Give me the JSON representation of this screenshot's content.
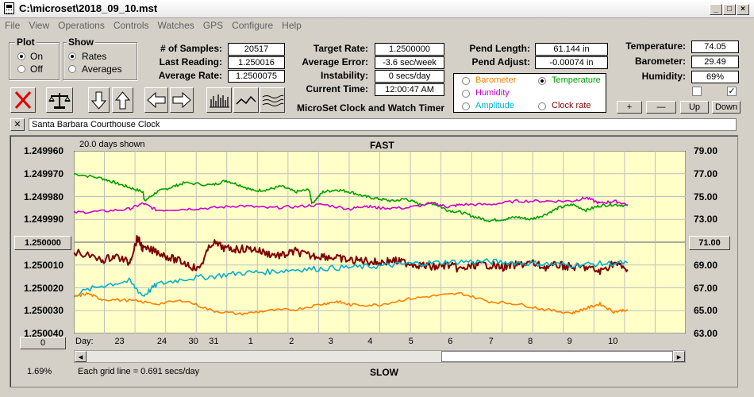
{
  "window": {
    "title": "C:\\microset\\2018_09_10.mst"
  },
  "menu": [
    "File",
    "View",
    "Operations",
    "Controls",
    "Watches",
    "GPS",
    "Configure",
    "Help"
  ],
  "plot_group": {
    "title": "Plot",
    "on": "On",
    "off": "Off",
    "selected": "On"
  },
  "show_group": {
    "title": "Show",
    "rates": "Rates",
    "averages": "Averages",
    "selected": "Rates"
  },
  "stats": {
    "samples_label": "# of Samples:",
    "samples": "20517",
    "last_label": "Last Reading:",
    "last": "1.250016",
    "avg_label": "Average Rate:",
    "avg": "1.2500075"
  },
  "rates": {
    "target_label": "Target Rate:",
    "target": "1.2500000",
    "error_label": "Average Error:",
    "error": "-3.6 sec/week",
    "instab_label": "Instability:",
    "instab": "0 secs/day",
    "time_label": "Current Time:",
    "time": "12:00:47 AM"
  },
  "app_name": "MicroSet Clock and Watch Timer",
  "pendulum": {
    "length_label": "Pend Length:",
    "length": "61.144 in",
    "adjust_label": "Pend Adjust:",
    "adjust": "-0.00074 in"
  },
  "env": {
    "temp_label": "Temperature:",
    "temp": "74.05",
    "baro_label": "Barometer:",
    "baro": "29.49",
    "hum_label": "Humidity:",
    "hum": "69%"
  },
  "selector": {
    "barometer": "Barometer",
    "temperature": "Temperature",
    "humidity": "Humidity",
    "amplitude": "Amplitude",
    "clock_rate": "Clock rate",
    "selected": "Temperature"
  },
  "colors": {
    "barometer": "#ff8000",
    "temperature": "#00a000",
    "humidity": "#d000d0",
    "amplitude": "#00b0d0",
    "rate": "#800000",
    "plot_bg": "#ffffc8"
  },
  "small_buttons": {
    "plus": "+",
    "minus": "—",
    "up": "Up",
    "down": "Down"
  },
  "watch_name": "Santa Barbara Courthouse Clock",
  "chart_header": {
    "days": "20.0 days shown",
    "fast": "FAST",
    "slow": "SLOW",
    "grid": "Each grid line = 0.691 secs/day",
    "percent": "1.69%",
    "day_label": "Day:"
  },
  "left_buttons": {
    "top": "1.250000",
    "bottom": "0"
  },
  "right_button": "71.00",
  "chart_data": {
    "type": "line",
    "y_left_ticks": [
      "1.249960",
      "1.249970",
      "1.249980",
      "1.249990",
      "1.250000",
      "1.250010",
      "1.250020",
      "1.250030",
      "1.250040"
    ],
    "y_right_ticks": [
      "79.00",
      "77.00",
      "75.00",
      "73.00",
      "71.00",
      "69.00",
      "67.00",
      "65.00",
      "63.00"
    ],
    "x_day_ticks": [
      "23",
      "24",
      "30",
      "31",
      "1",
      "2",
      "3",
      "4",
      "5",
      "6",
      "7",
      "8",
      "9",
      "10"
    ],
    "ylim_right": [
      63,
      79
    ],
    "ylim_left": [
      1.24996,
      1.25004
    ],
    "series": [
      {
        "name": "Temperature",
        "color": "#00a000",
        "axis": "right",
        "x": [
          0,
          1,
          1.5,
          2,
          2.5,
          2.55,
          3,
          3.5,
          4,
          5,
          5.5,
          6,
          6.5,
          7,
          7.5,
          8,
          8.5,
          8.6,
          9,
          9.5,
          10,
          10.5,
          11,
          11.5,
          12,
          12.5,
          13,
          13.5,
          14,
          14.5,
          15,
          15.5,
          16,
          16.5,
          17,
          17.5,
          18,
          18.5,
          19,
          19.5,
          20
        ],
        "values": [
          77.0,
          76.6,
          76.2,
          75.8,
          75.4,
          74.6,
          75.4,
          75.8,
          76.2,
          76.0,
          76.4,
          76.0,
          75.5,
          75.6,
          75.9,
          75.4,
          75.6,
          74.4,
          75.4,
          75.6,
          75.4,
          75.0,
          74.8,
          74.6,
          74.8,
          74.3,
          74.4,
          73.8,
          73.6,
          73.2,
          72.9,
          73.0,
          73.2,
          73.0,
          73.4,
          74.0,
          74.3,
          73.8,
          74.2,
          74.3,
          74.2
        ]
      },
      {
        "name": "Humidity",
        "color": "#d000d0",
        "axis": "right",
        "x": [
          0,
          1,
          2,
          2.5,
          3,
          4,
          5,
          6,
          7,
          8,
          9,
          10,
          10.5,
          11,
          12,
          13,
          13.5,
          14,
          15,
          16,
          17,
          18,
          18.5,
          19,
          19.5,
          20
        ],
        "values": [
          73.6,
          73.7,
          73.9,
          74.4,
          73.8,
          73.9,
          74.0,
          74.2,
          74.0,
          74.1,
          74.3,
          73.9,
          74.2,
          74.0,
          74.0,
          74.4,
          74.1,
          74.3,
          74.3,
          74.6,
          74.6,
          74.6,
          74.9,
          74.4,
          74.6,
          74.3
        ]
      },
      {
        "name": "Clock rate",
        "color": "#800000",
        "axis": "left",
        "x": [
          0,
          1,
          1.5,
          2,
          2.3,
          2.5,
          3,
          3.5,
          4,
          4.5,
          5,
          5.5,
          6,
          6.5,
          7,
          7.5,
          8,
          8.5,
          9,
          9.5,
          10,
          10.5,
          11,
          11.5,
          12,
          12.5,
          13,
          13.5,
          14,
          14.5,
          15,
          15.5,
          16,
          16.5,
          17,
          17.5,
          18,
          18.5,
          19,
          19.5,
          20
        ],
        "values": [
          1.250004,
          1.250008,
          1.250006,
          1.250009,
          1.249998,
          1.250003,
          1.250004,
          1.250007,
          1.250009,
          1.250012,
          1.25,
          1.250003,
          1.250003,
          1.250003,
          1.250005,
          1.250006,
          1.250004,
          1.250006,
          1.250006,
          1.250007,
          1.250008,
          1.250008,
          1.250009,
          1.250008,
          1.250009,
          1.25001,
          1.250011,
          1.25001,
          1.250012,
          1.25001,
          1.25001,
          1.250011,
          1.25001,
          1.250009,
          1.250011,
          1.25001,
          1.250011,
          1.250011,
          1.250013,
          1.250009,
          1.250012
        ]
      },
      {
        "name": "Amplitude",
        "color": "#00b0d0",
        "axis": "right",
        "x": [
          0,
          1,
          2,
          2.5,
          3,
          4,
          5,
          6,
          7,
          8,
          9,
          10,
          11,
          12,
          13,
          14,
          15,
          16,
          17,
          18,
          19,
          20
        ],
        "values": [
          66.4,
          67.2,
          67.6,
          66.3,
          67.3,
          67.8,
          68.0,
          68.3,
          68.4,
          68.6,
          68.7,
          68.8,
          68.9,
          69.1,
          69.2,
          69.3,
          69.3,
          69.2,
          69.1,
          69.0,
          69.1,
          69.2
        ]
      },
      {
        "name": "Barometer",
        "color": "#ff8000",
        "axis": "right",
        "x": [
          0,
          0.5,
          1,
          2,
          3,
          4,
          5,
          6,
          7,
          8,
          9,
          9.5,
          10,
          11,
          12,
          13,
          14,
          15,
          16,
          17,
          18,
          18.5,
          19,
          19.5,
          20
        ],
        "values": [
          66.2,
          66.5,
          66.0,
          65.9,
          65.6,
          65.9,
          65.0,
          64.7,
          65.0,
          65.1,
          65.6,
          65.8,
          65.5,
          65.5,
          66.0,
          66.3,
          66.5,
          65.8,
          65.6,
          65.1,
          64.8,
          65.2,
          65.6,
          64.9,
          65.1
        ]
      }
    ]
  }
}
